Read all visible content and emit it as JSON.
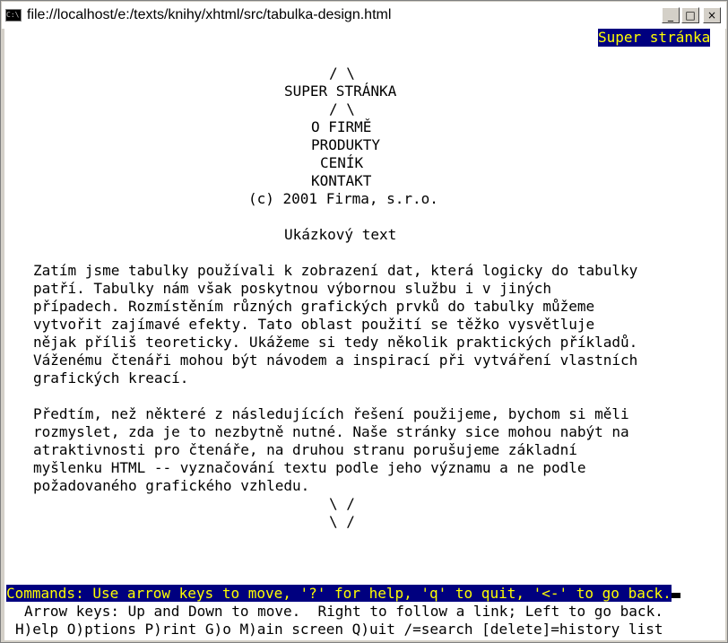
{
  "window": {
    "title": "file://localhost/e:/texts/knihy/xhtml/src/tabulka-design.html",
    "icon_glyph": "C:\\",
    "buttons": {
      "minimize": "_",
      "maximize": "□",
      "close": "×"
    }
  },
  "page": {
    "title_bar_label": "Super stránka",
    "header": {
      "arrow_up_1": "/ \\",
      "site_name": "SUPER STRÁNKA",
      "arrow_up_2": "/ \\"
    },
    "nav": [
      {
        "label": "O FIRMĚ"
      },
      {
        "label": "PRODUKTY"
      },
      {
        "label": "CENÍK"
      },
      {
        "label": "KONTAKT"
      }
    ],
    "copyright": "(c) 2001 Firma, s.r.o.",
    "heading": "Ukázkový text",
    "paragraph1": [
      "Zatím jsme tabulky používali k zobrazení dat, která logicky do tabulky",
      "patří. Tabulky nám však poskytnou výbornou službu i v jiných",
      "případech. Rozmístěním různých grafických prvků do tabulky můžeme",
      "vytvořit zajímavé efekty. Tato oblast použití se těžko vysvětluje",
      "nějak příliš teoreticky. Ukážeme si tedy několik praktických příkladů.",
      "Váženému čtenáři mohou být návodem a inspirací při vytváření vlastních",
      "grafických kreací."
    ],
    "paragraph2": [
      "Předtím, než některé z následujících řešení použijeme, bychom si měli",
      "rozmyslet, zda je to nezbytně nutné. Naše stránky sice mohou nabýt na",
      "atraktivnosti pro čtenáře, na druhou stranu porušujeme základní",
      "myšlenku HTML -- vyznačování textu podle jeho významu a ne podle",
      "požadovaného grafického vzhledu."
    ],
    "footer_arrows": [
      "\\ /",
      "\\ /"
    ]
  },
  "status": {
    "commands": "Commands: Use arrow keys to move, '?' for help, 'q' to quit, '<-' to go back.",
    "hint": "Arrow keys: Up and Down to move.  Right to follow a link; Left to go back.",
    "menu": "H)elp O)ptions P)rint G)o M)ain screen Q)uit /=search [delete]=history list"
  }
}
